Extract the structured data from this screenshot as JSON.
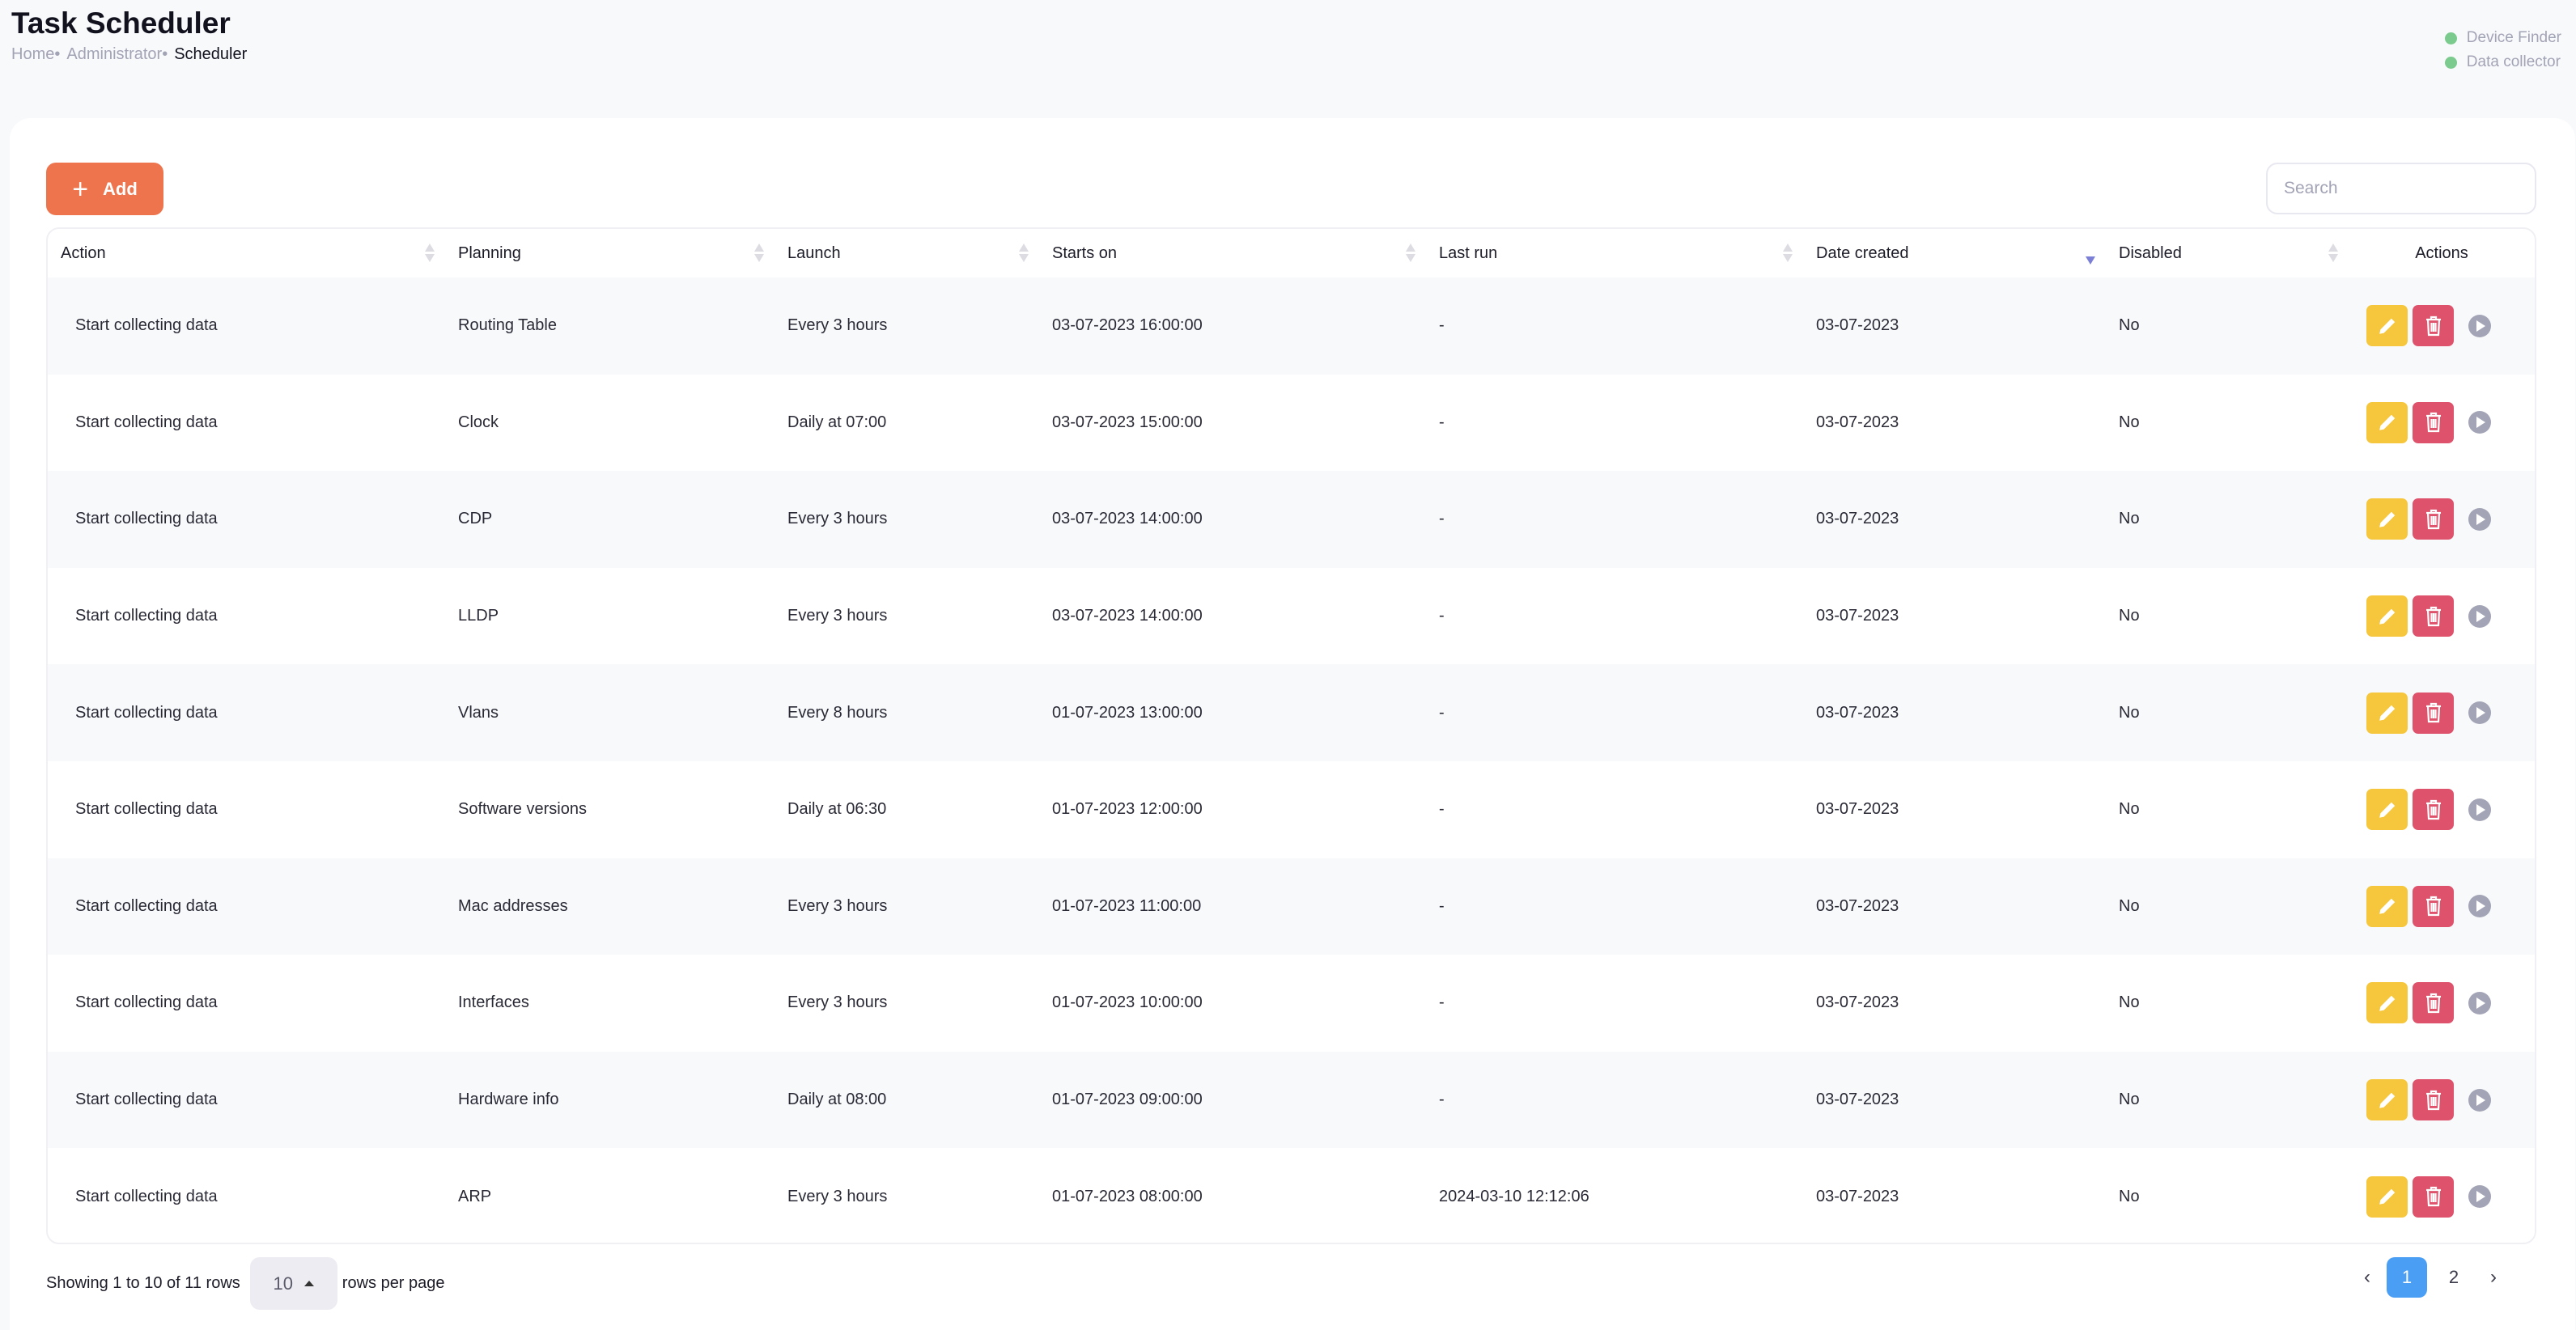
{
  "header": {
    "title": "Task Scheduler",
    "breadcrumb": [
      "Home",
      "Administrator",
      "Scheduler"
    ]
  },
  "services": [
    {
      "label": "Device Finder",
      "status_color": "#7acb8d"
    },
    {
      "label": "Data collector",
      "status_color": "#7acb8d"
    }
  ],
  "toolbar": {
    "add_label": "Add",
    "search_placeholder": "Search"
  },
  "table": {
    "columns": [
      "Action",
      "Planning",
      "Launch",
      "Starts on",
      "Last run",
      "Date created",
      "Disabled",
      "Actions"
    ],
    "sorted_column": "Date created",
    "sort_direction": "desc",
    "rows": [
      [
        "Start collecting data",
        "Routing Table",
        "Every 3 hours",
        "03-07-2023 16:00:00",
        "-",
        "03-07-2023",
        "No"
      ],
      [
        "Start collecting data",
        "Clock",
        "Daily at 07:00",
        "03-07-2023 15:00:00",
        "-",
        "03-07-2023",
        "No"
      ],
      [
        "Start collecting data",
        "CDP",
        "Every 3 hours",
        "03-07-2023 14:00:00",
        "-",
        "03-07-2023",
        "No"
      ],
      [
        "Start collecting data",
        "LLDP",
        "Every 3 hours",
        "03-07-2023 14:00:00",
        "-",
        "03-07-2023",
        "No"
      ],
      [
        "Start collecting data",
        "Vlans",
        "Every 8 hours",
        "01-07-2023 13:00:00",
        "-",
        "03-07-2023",
        "No"
      ],
      [
        "Start collecting data",
        "Software versions",
        "Daily at 06:30",
        "01-07-2023 12:00:00",
        "-",
        "03-07-2023",
        "No"
      ],
      [
        "Start collecting data",
        "Mac addresses",
        "Every 3 hours",
        "01-07-2023 11:00:00",
        "-",
        "03-07-2023",
        "No"
      ],
      [
        "Start collecting data",
        "Interfaces",
        "Every 3 hours",
        "01-07-2023 10:00:00",
        "-",
        "03-07-2023",
        "No"
      ],
      [
        "Start collecting data",
        "Hardware info",
        "Daily at 08:00",
        "01-07-2023 09:00:00",
        "-",
        "03-07-2023",
        "No"
      ],
      [
        "Start collecting data",
        "ARP",
        "Every 3 hours",
        "01-07-2023 08:00:00",
        "2024-03-10 12:12:06",
        "03-07-2023",
        "No"
      ]
    ]
  },
  "footer": {
    "showing": "Showing 1 to 10 of 11 rows",
    "page_size": "10",
    "rows_per_page": "rows per page"
  },
  "pagination": {
    "prev": "‹",
    "pages": [
      "1",
      "2"
    ],
    "current": "1",
    "next": "›"
  },
  "colors": {
    "add": "#ed744d",
    "edit": "#f6c73d",
    "delete": "#de526c",
    "active_page": "#4a9ff5"
  }
}
